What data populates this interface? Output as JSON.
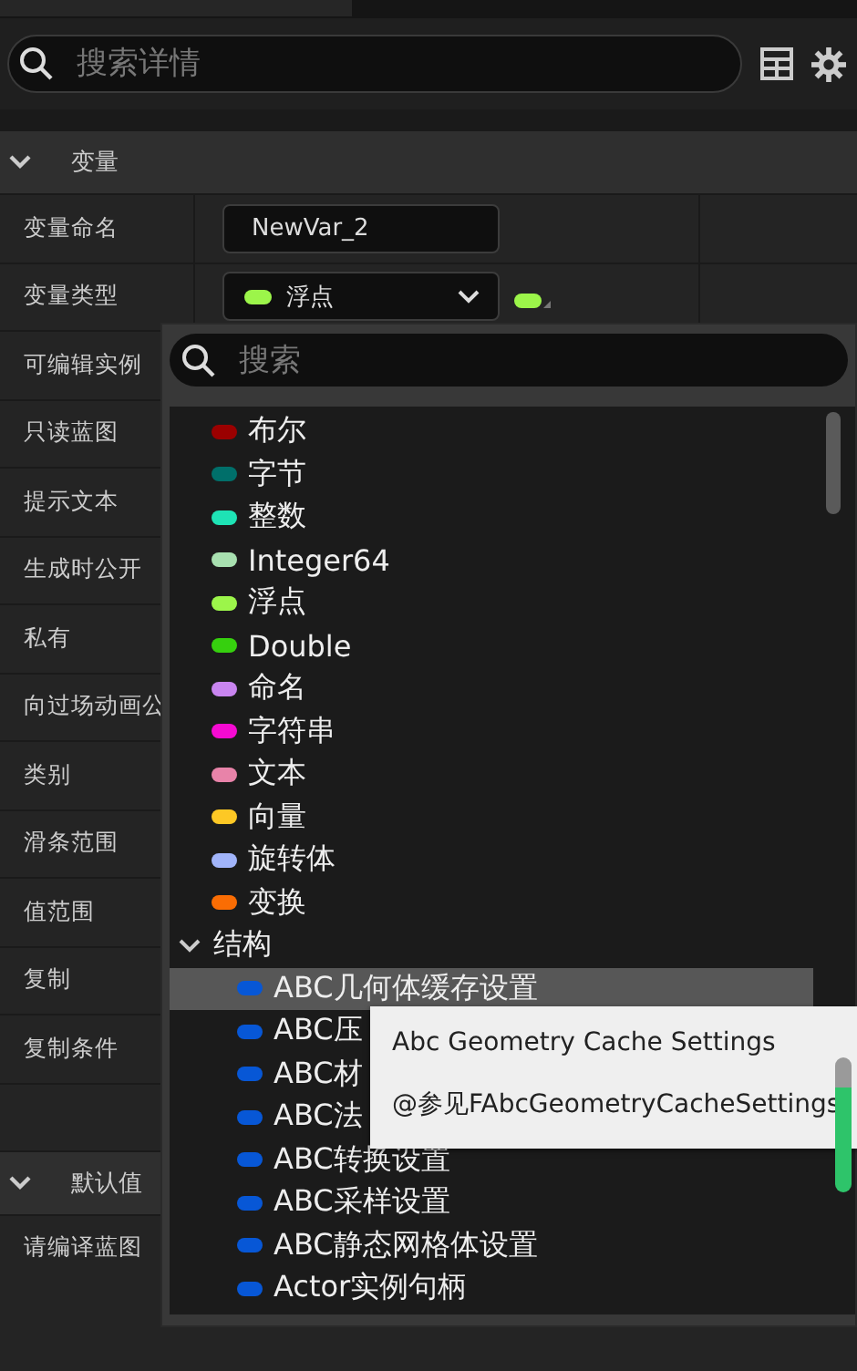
{
  "search": {
    "placeholder": "搜索详情"
  },
  "sections": [
    {
      "title": "变量",
      "expanded": true,
      "rows": [
        {
          "label": "变量命名",
          "kind": "text",
          "value": "NewVar_2"
        },
        {
          "label": "变量类型",
          "kind": "type",
          "value": "浮点",
          "color": "#9cf54a"
        },
        {
          "label": "可编辑实例",
          "kind": "plain"
        },
        {
          "label": "只读蓝图",
          "kind": "plain"
        },
        {
          "label": "提示文本",
          "kind": "plain"
        },
        {
          "label": "生成时公开",
          "kind": "plain"
        },
        {
          "label": "私有",
          "kind": "plain"
        },
        {
          "label": "向过场动画公",
          "kind": "plain"
        },
        {
          "label": "类别",
          "kind": "plain"
        },
        {
          "label": "滑条范围",
          "kind": "plain"
        },
        {
          "label": "值范围",
          "kind": "plain"
        },
        {
          "label": "复制",
          "kind": "plain"
        },
        {
          "label": "复制条件",
          "kind": "plain"
        },
        {
          "kind": "blank"
        }
      ]
    },
    {
      "title": "默认值",
      "expanded": true,
      "rows": [
        {
          "label": "请编译蓝图",
          "kind": "plain"
        }
      ]
    }
  ],
  "type_picker": {
    "search": {
      "placeholder": "搜索"
    },
    "items": [
      {
        "label": "布尔",
        "color": "#9b0000",
        "selected": false
      },
      {
        "label": "字节",
        "color": "#006f6a",
        "selected": false
      },
      {
        "label": "整数",
        "color": "#1ee3b5",
        "selected": false
      },
      {
        "label": "Integer64",
        "color": "#a8e0b0",
        "selected": false
      },
      {
        "label": "浮点",
        "color": "#9cf54a",
        "selected": false
      },
      {
        "label": "Double",
        "color": "#36d00e",
        "selected": false
      },
      {
        "label": "命名",
        "color": "#c985f0",
        "selected": false
      },
      {
        "label": "字符串",
        "color": "#f50ad2",
        "selected": false
      },
      {
        "label": "文本",
        "color": "#e883a9",
        "selected": false
      },
      {
        "label": "向量",
        "color": "#fdc825",
        "selected": false
      },
      {
        "label": "旋转体",
        "color": "#a1b4fa",
        "selected": false
      },
      {
        "label": "变换",
        "color": "#fa6d04",
        "selected": false
      },
      {
        "label": "结构",
        "expanded": true,
        "selected": false,
        "children": [
          {
            "label": "ABC几何体缓存设置",
            "color": "#0757d6",
            "selected": true
          },
          {
            "label": "ABC压",
            "color": "#0757d6",
            "selected": false
          },
          {
            "label": "ABC材",
            "color": "#0757d6",
            "selected": false
          },
          {
            "label": "ABC法",
            "color": "#0757d6",
            "selected": false
          },
          {
            "label": "ABC转换设置",
            "color": "#0757d6",
            "selected": false
          },
          {
            "label": "ABC采样设置",
            "color": "#0757d6",
            "selected": false
          },
          {
            "label": "ABC静态网格体设置",
            "color": "#0757d6",
            "selected": false
          },
          {
            "label": "Actor实例句柄",
            "color": "#0757d6",
            "selected": false
          }
        ]
      }
    ]
  },
  "tooltip": {
    "title": "Abc Geometry Cache Settings",
    "text": "@参见FAbcGeometryCacheSettings"
  }
}
